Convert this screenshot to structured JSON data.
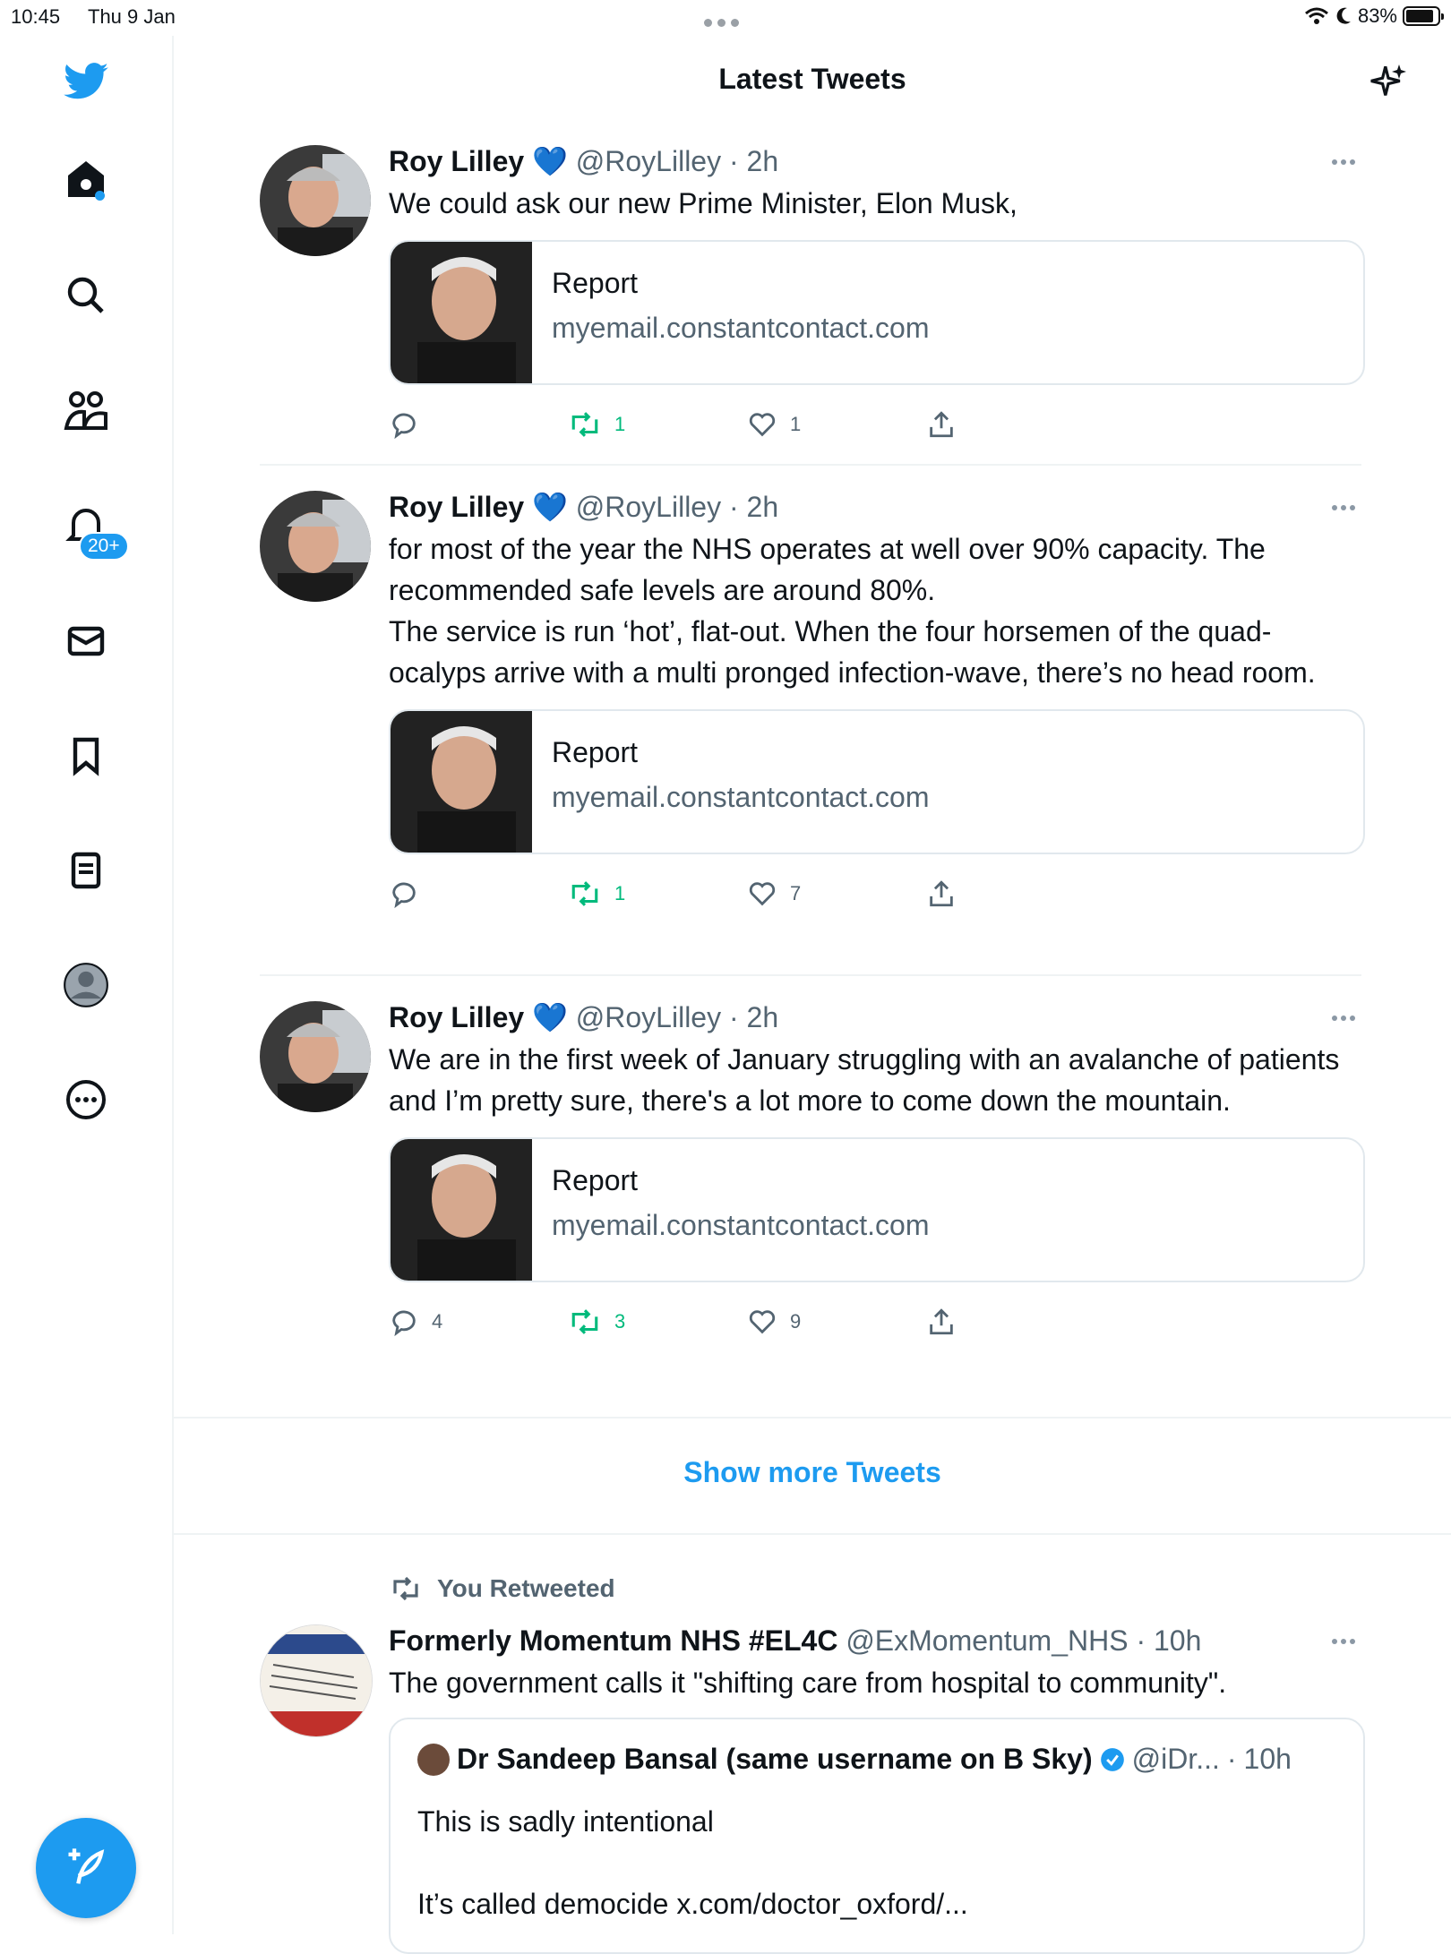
{
  "status_bar": {
    "time": "10:45",
    "date": "Thu 9 Jan",
    "battery": "83%"
  },
  "sidebar": {
    "notifications_badge": "20+"
  },
  "header": {
    "title": "Latest Tweets"
  },
  "tweets": [
    {
      "name": "Roy Lilley",
      "handle": "@RoyLilley",
      "time": "2h",
      "text": "We could ask our new Prime Minister, Elon Musk,",
      "card_title": "Report",
      "card_domain": "myemail.constantcontact.com",
      "replies": "",
      "retweets": "1",
      "likes": "1"
    },
    {
      "name": "Roy Lilley",
      "handle": "@RoyLilley",
      "time": "2h",
      "text": "for most of the year the NHS operates at well over 90% capacity. The recommended safe levels are around 80%.\nThe service is run ‘hot’, flat-out. When the four horsemen of the quad-ocalyps arrive with a multi pronged infection-wave, there’s no head room.",
      "card_title": "Report",
      "card_domain": "myemail.constantcontact.com",
      "replies": "",
      "retweets": "1",
      "likes": "7"
    },
    {
      "name": "Roy Lilley",
      "handle": "@RoyLilley",
      "time": "2h",
      "text": "We are in the first week of January struggling with an avalanche of patients and I’m pretty sure, there's a lot more to come down the mountain.",
      "card_title": "Report",
      "card_domain": "myemail.constantcontact.com",
      "replies": "4",
      "retweets": "3",
      "likes": "9"
    }
  ],
  "show_more": "Show more Tweets",
  "retweet": {
    "label": "You Retweeted",
    "name": "Formerly Momentum NHS #EL4C",
    "handle": "@ExMomentum_NHS",
    "time": "10h",
    "text": "The government calls it \"shifting care from hospital to community\".",
    "quote": {
      "name": "Dr Sandeep Bansal (same username on B Sky)",
      "handle": "@iDr...",
      "time": "10h",
      "text1": "This is sadly intentional",
      "text2": "It’s called democide x.com/doctor_oxford/..."
    }
  },
  "colors": {
    "accent": "#1d9bf0",
    "retweet_green": "#00ba7c",
    "muted": "#536471"
  }
}
